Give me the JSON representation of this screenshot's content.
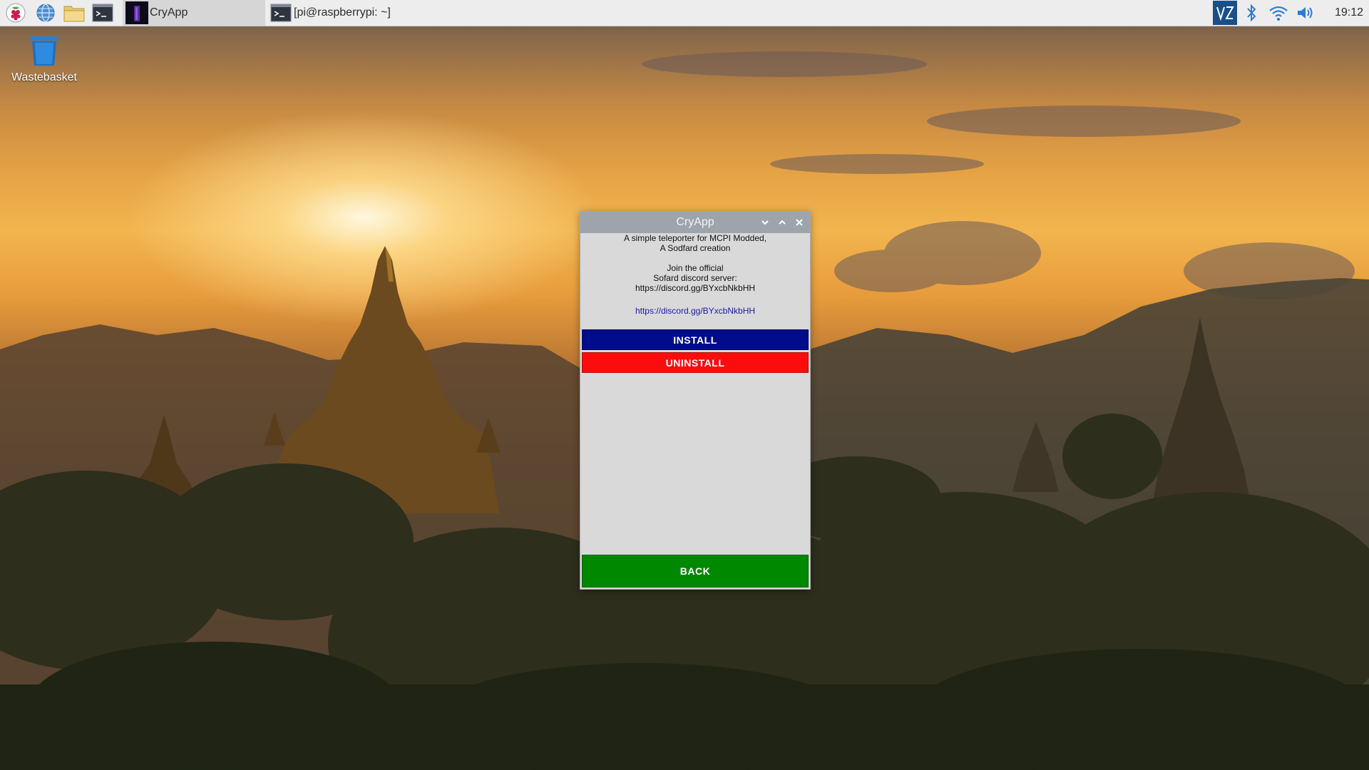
{
  "taskbar": {
    "launchers": [
      {
        "icon": "raspberry-menu-icon"
      },
      {
        "icon": "web-browser-icon"
      },
      {
        "icon": "file-manager-icon"
      },
      {
        "icon": "terminal-icon"
      }
    ],
    "tasks": [
      {
        "label": "CryApp",
        "icon": "cryapp-icon",
        "active": true
      },
      {
        "label": "[pi@raspberrypi: ~]",
        "icon": "terminal-icon",
        "active": false
      }
    ],
    "tray": {
      "icons": [
        "vnc-icon",
        "bluetooth-icon",
        "wifi-icon",
        "volume-icon"
      ],
      "clock": "19:12"
    }
  },
  "desktop": {
    "icons": [
      {
        "label": "Wastebasket",
        "icon": "wastebasket-icon"
      }
    ]
  },
  "window": {
    "title": "CryApp",
    "controls": [
      "minimize",
      "maximize",
      "close"
    ],
    "lines": {
      "line1": "A simple teleporter for MCPI Modded,",
      "line2": "A Sodfard creation",
      "line3": "Join the official",
      "line4": "Sofard discord server:",
      "line5": "https://discord.gg/BYxcbNkbHH"
    },
    "link": "https://discord.gg/BYxcbNkbHH",
    "buttons": {
      "install": "INSTALL",
      "uninstall": "UNINSTALL",
      "back": "BACK"
    },
    "colors": {
      "install": "#000c8a",
      "uninstall": "#fc0d0d",
      "back": "#008800",
      "titlebar": "#9ea4ac"
    }
  }
}
